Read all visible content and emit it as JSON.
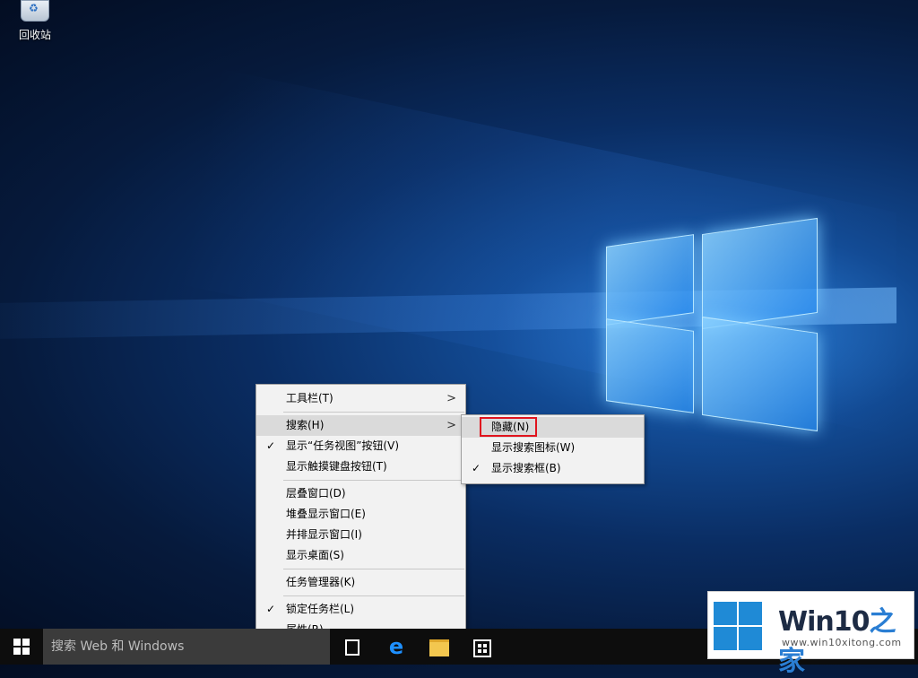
{
  "desktop": {
    "icons": [
      {
        "label": "回收站",
        "icon": "recycle-bin-icon"
      }
    ]
  },
  "context_menu": {
    "items": [
      {
        "label": "工具栏(T)",
        "checked": false,
        "submenu": true
      },
      {
        "label": "搜索(H)",
        "checked": false,
        "submenu": true,
        "highlighted": true
      },
      {
        "label": "显示“任务视图”按钮(V)",
        "checked": true
      },
      {
        "label": "显示触摸键盘按钮(T)",
        "checked": false
      },
      {
        "label": "层叠窗口(D)"
      },
      {
        "label": "堆叠显示窗口(E)"
      },
      {
        "label": "并排显示窗口(I)"
      },
      {
        "label": "显示桌面(S)"
      },
      {
        "label": "任务管理器(K)"
      },
      {
        "label": "锁定任务栏(L)",
        "checked": true
      },
      {
        "label": "属性(R)"
      }
    ]
  },
  "search_submenu": {
    "items": [
      {
        "label": "隐藏(N)",
        "checked": false,
        "highlighted": true
      },
      {
        "label": "显示搜索图标(W)",
        "checked": false
      },
      {
        "label": "显示搜索框(B)",
        "checked": true
      }
    ]
  },
  "taskbar": {
    "search_placeholder": "搜索 Web 和 Windows",
    "apps": [
      "task-view-icon",
      "edge-icon",
      "file-explorer-icon",
      "store-icon"
    ]
  },
  "watermark": {
    "brand_prefix": "Win10",
    "brand_suffix": "之家",
    "url": "www.win10xitong.com"
  },
  "colors": {
    "highlight_box": "#e0141e",
    "taskbar": "#0d0d0d",
    "search_box": "#3b3b3b",
    "badge_logo": "#1f8ad6"
  }
}
